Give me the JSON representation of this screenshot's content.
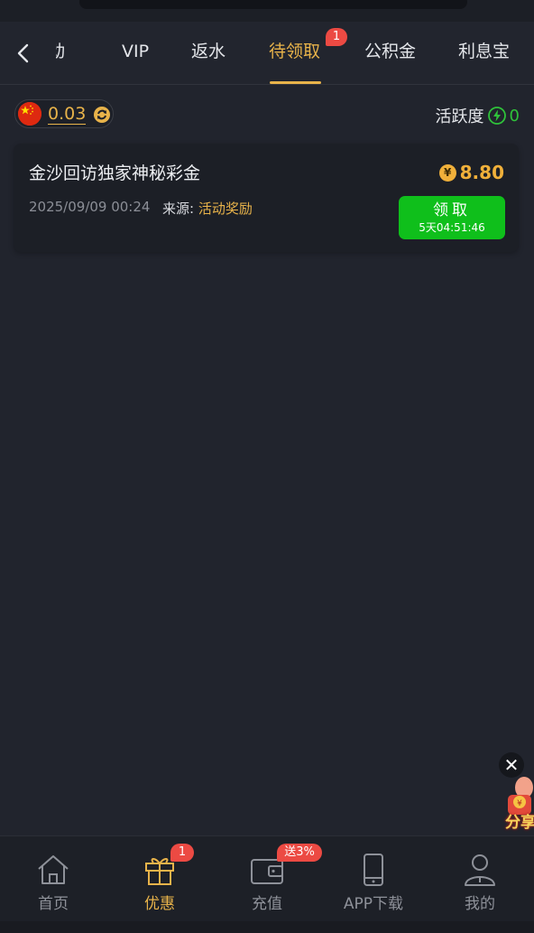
{
  "tabs": {
    "items": [
      "活动",
      "VIP",
      "返水",
      "待领取",
      "公积金",
      "利息宝"
    ],
    "active_index": 3,
    "active_badge": "1"
  },
  "balance": {
    "flag": "china-flag",
    "value": "0.03"
  },
  "activity": {
    "label": "活跃度",
    "value": "0"
  },
  "card": {
    "title": "金沙回访独家神秘彩金",
    "amount": "8.80",
    "currency_symbol": "¥",
    "time": "2025/09/09 00:24",
    "source_label": "来源:",
    "source_value": "活动奖励",
    "claim_label": "领取",
    "countdown": "5天04:51:46"
  },
  "floating": {
    "close": "✕",
    "share_text": "分享"
  },
  "bottom_nav": {
    "items": [
      {
        "label": "首页",
        "icon": "home-icon"
      },
      {
        "label": "优惠",
        "icon": "gift-icon",
        "badge": "1"
      },
      {
        "label": "充值",
        "icon": "wallet-icon",
        "badge": "送3%"
      },
      {
        "label": "APP下载",
        "icon": "phone-icon"
      },
      {
        "label": "我的",
        "icon": "user-icon"
      }
    ],
    "active_index": 1
  },
  "colors": {
    "background": "#21242d",
    "accent": "#e8b34a",
    "claim_green": "#0fbf1b",
    "badge_red": "#ec4a43"
  }
}
